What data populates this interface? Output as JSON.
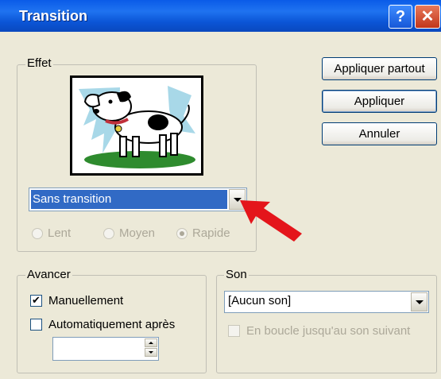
{
  "window": {
    "title": "Transition",
    "help_glyph": "?",
    "close_glyph": "✕"
  },
  "effect": {
    "legend": "Effet",
    "selected": "Sans transition",
    "speeds": [
      {
        "label": "Lent",
        "checked": false
      },
      {
        "label": "Moyen",
        "checked": false
      },
      {
        "label": "Rapide",
        "checked": true
      }
    ]
  },
  "buttons": {
    "apply_all": "Appliquer partout",
    "apply": "Appliquer",
    "cancel": "Annuler"
  },
  "advance": {
    "legend": "Avancer",
    "manual_label": "Manuellement",
    "manual_checked": true,
    "auto_label": "Automatiquement après",
    "auto_checked": false,
    "auto_value": ""
  },
  "sound": {
    "legend": "Son",
    "selected": "[Aucun son]",
    "loop_label": "En boucle jusqu'au son suivant",
    "loop_checked": false
  },
  "colors": {
    "titlebar": "#0A5BE8",
    "selection": "#316AC5",
    "annotation_arrow": "#E4151B"
  },
  "icons": [
    "help-icon",
    "close-icon",
    "dog-clipart",
    "dropdown-arrow-icon",
    "red-pointer-arrow-icon"
  ]
}
